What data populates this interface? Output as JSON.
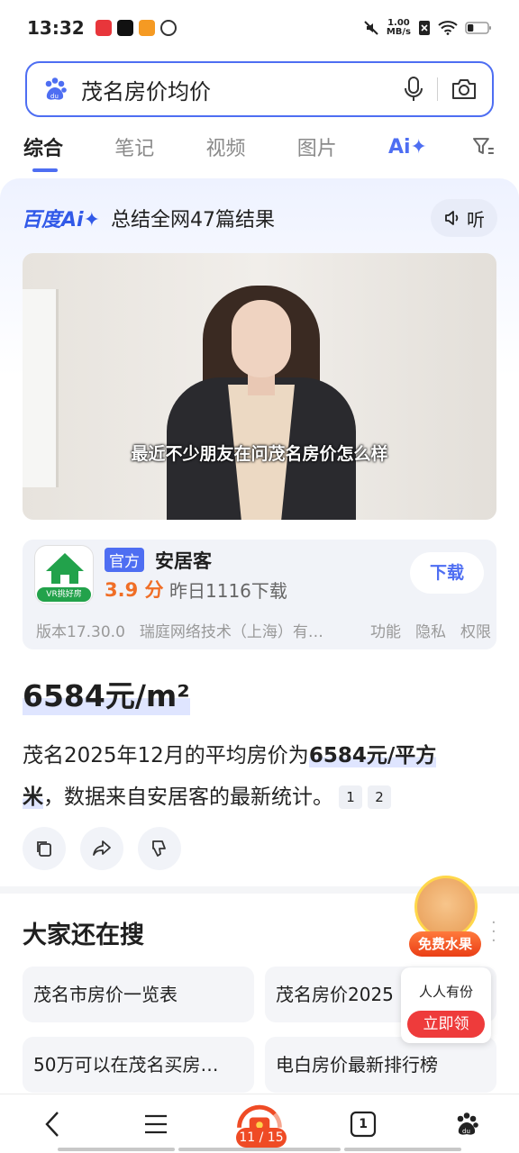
{
  "status": {
    "time": "13:32",
    "speed_value": "1.00",
    "speed_unit": "MB/s",
    "battery_level": 0.3
  },
  "search": {
    "query": "茂名房价均价"
  },
  "tabs": [
    {
      "label": "综合",
      "active": true
    },
    {
      "label": "笔记"
    },
    {
      "label": "视频"
    },
    {
      "label": "图片"
    },
    {
      "label": "Ai✦"
    }
  ],
  "ai": {
    "brand": "百度Ai✦",
    "summary": "总结全网47篇结果",
    "listen_label": "听",
    "video_subtitle": "最近不少朋友在问茂名房价怎么样"
  },
  "app_card": {
    "icon_tag": "VR挑好房",
    "official_badge": "官方",
    "name": "安居客",
    "rating": "3.9 分",
    "downloads": "昨日1116下载",
    "download_label": "下载",
    "version": "版本17.30.0",
    "developer": "瑞庭网络技术（上海）有…",
    "link_features": "功能",
    "link_privacy": "隐私",
    "link_permissions": "权限"
  },
  "answer": {
    "big_price": "6584元/m²",
    "text_prefix": "茂名2025年12月的平均房价为",
    "highlight": "6584元/平方米",
    "text_suffix": "，数据来自安居客的最新统计。",
    "ref1": "1",
    "ref2": "2"
  },
  "related": {
    "title": "大家还在搜",
    "items": [
      "茂名市房价一览表",
      "茂名房价2025",
      "50万可以在茂名买房…",
      "电白房价最新排行榜"
    ]
  },
  "promo": {
    "fruit_label": "免费水果",
    "claim_text": "人人有份",
    "claim_button": "立即领"
  },
  "bottom_nav": {
    "tabs_count": "1",
    "task_progress": "11 / 15"
  },
  "colors": {
    "brand_blue": "#4e6ef2",
    "rating_orange": "#f06e26",
    "promo_red": "#ee3b3b"
  }
}
